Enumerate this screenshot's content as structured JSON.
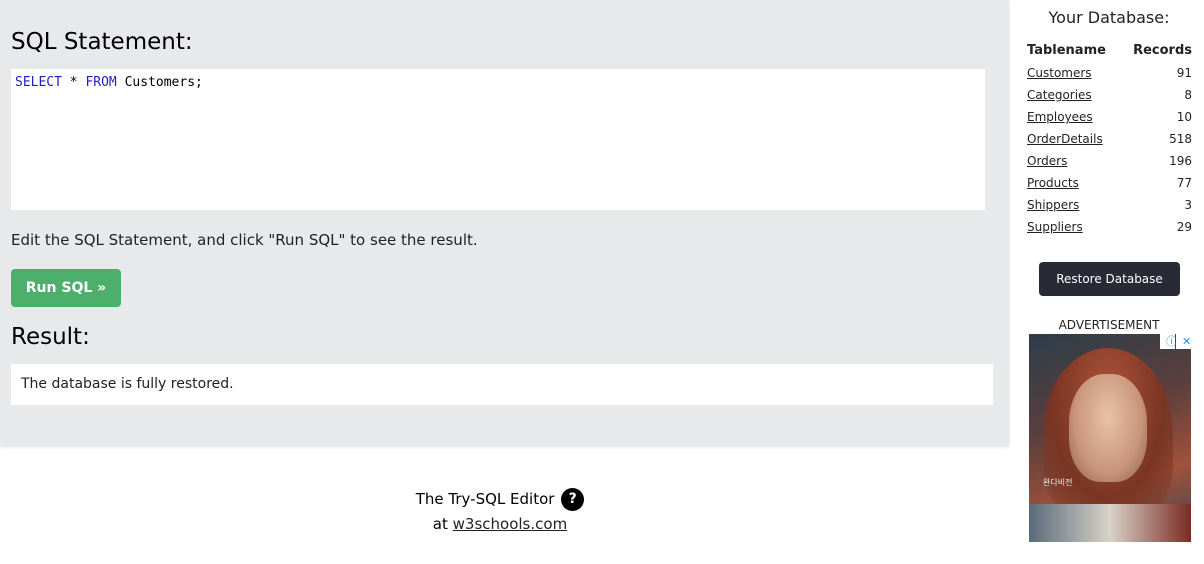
{
  "editor": {
    "heading": "SQL Statement:",
    "keyword_select": "SELECT",
    "star": "*",
    "keyword_from": "FROM",
    "table": "Customers;",
    "instructions": "Edit the SQL Statement, and click \"Run SQL\" to see the result.",
    "run_button": "Run SQL »"
  },
  "result": {
    "heading": "Result:",
    "message": "The database is fully restored."
  },
  "footer": {
    "line1": "The Try-SQL Editor",
    "help_glyph": "?",
    "at": "at",
    "link": "w3schools.com"
  },
  "database": {
    "heading": "Your Database:",
    "columns": [
      "Tablename",
      "Records"
    ],
    "tables": [
      {
        "name": "Customers",
        "records": "91"
      },
      {
        "name": "Categories",
        "records": "8"
      },
      {
        "name": "Employees",
        "records": "10"
      },
      {
        "name": "OrderDetails",
        "records": "518"
      },
      {
        "name": "Orders",
        "records": "196"
      },
      {
        "name": "Products",
        "records": "77"
      },
      {
        "name": "Shippers",
        "records": "3"
      },
      {
        "name": "Suppliers",
        "records": "29"
      }
    ],
    "restore_button": "Restore Database"
  },
  "advertisement": {
    "label": "ADVERTISEMENT",
    "image_text": "완다비전",
    "info_glyph": "ⓘ",
    "close_glyph": "✕"
  },
  "colors": {
    "panel_background": "#e7e9eb",
    "run_button": "#4caf6c",
    "restore_button": "#282a35",
    "sql_keyword": "#1f1fc2"
  }
}
